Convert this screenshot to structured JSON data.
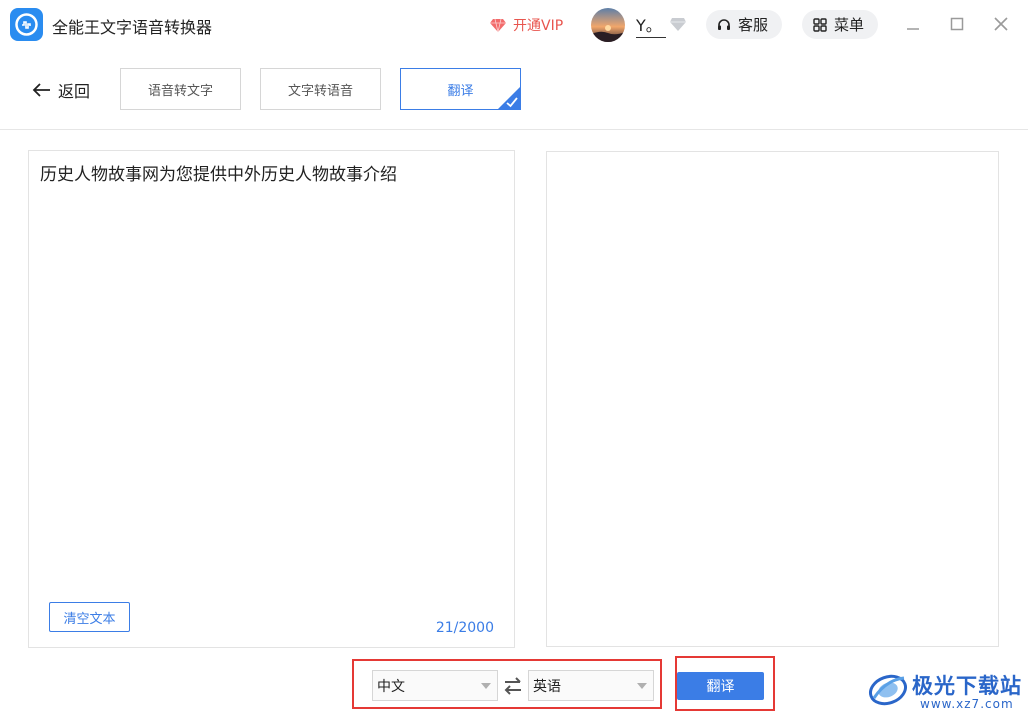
{
  "app": {
    "title": "全能王文字语音转换器"
  },
  "header": {
    "vip_label": "开通VIP",
    "username": "Y。",
    "service_label": "客服",
    "menu_label": "菜单"
  },
  "nav": {
    "back_label": "返回",
    "tabs": [
      {
        "label": "语音转文字",
        "active": false
      },
      {
        "label": "文字转语音",
        "active": false
      },
      {
        "label": "翻译",
        "active": true
      }
    ]
  },
  "source": {
    "text": "历史人物故事网为您提供中外历史人物故事介绍",
    "clear_label": "清空文本",
    "counter": "21/2000"
  },
  "target": {
    "text": ""
  },
  "controls": {
    "from_language": "中文",
    "to_language": "英语",
    "translate_label": "翻译"
  },
  "watermark": {
    "brand": "极光下载站",
    "domain": "www.xz7.com"
  },
  "colors": {
    "accent": "#3b7de6",
    "highlight": "#e53935",
    "vip": "#e8554e"
  }
}
